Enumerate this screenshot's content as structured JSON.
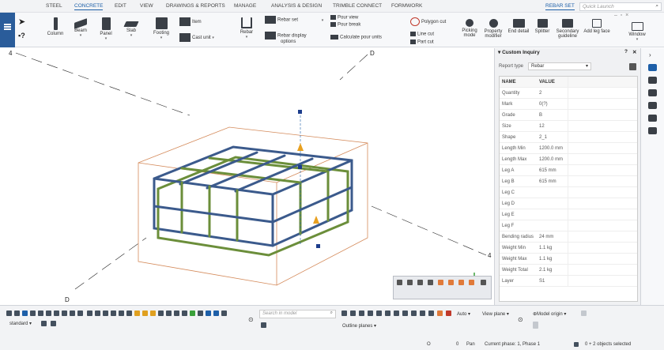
{
  "menu": {
    "tabs": [
      "STEEL",
      "CONCRETE",
      "EDIT",
      "VIEW",
      "DRAWINGS & REPORTS",
      "MANAGE",
      "ANALYSIS & DESIGN",
      "TRIMBLE CONNECT",
      "FORMWORK"
    ],
    "active_tab": "CONCRETE",
    "context_tab": "REBAR SET",
    "search_placeholder": "Quick Launch"
  },
  "ribbon": {
    "column": "Column",
    "beam": "Beam",
    "panel": "Panel",
    "slab": "Slab",
    "footing": "Footing",
    "item": "Item",
    "cast_unit": "Cast unit",
    "rebar": "Rebar",
    "rebar_set": "Rebar set",
    "rebar_display": "Rebar display",
    "options": "options",
    "pour_view": "Pour view",
    "pour_break": "Pour break",
    "calculate_pour_units": "Calculate pour units",
    "polygon_cut": "Polygon cut",
    "line_cut": "Line cut",
    "part_cut": "Part cut",
    "picking": "Picking",
    "mode": "mode",
    "property": "Property",
    "modifier": "modifier",
    "end_detail": "End detail",
    "splitter": "Splitter",
    "secondary": "Secondary",
    "guideline": "guideline",
    "add_leg_face": "Add leg face",
    "window": "Window"
  },
  "viewport": {
    "grid_labels": [
      "4",
      "D",
      "D",
      "4"
    ]
  },
  "panel": {
    "title": "Custom Inquiry",
    "report_type_label": "Report type",
    "report_type_value": "Rebar",
    "columns": [
      "NAME",
      "VALUE"
    ],
    "rows": [
      {
        "name": "Quantity",
        "value": "2"
      },
      {
        "name": "Mark",
        "value": "0(?)"
      },
      {
        "name": "Grade",
        "value": "B"
      },
      {
        "name": "Size",
        "value": "12"
      },
      {
        "name": "Shape",
        "value": "2_1"
      },
      {
        "name": "Length Min",
        "value": "1200.0 mm"
      },
      {
        "name": "Length Max",
        "value": "1200.0 mm"
      },
      {
        "name": "Leg A",
        "value": "615 mm"
      },
      {
        "name": "Leg B",
        "value": "615 mm"
      },
      {
        "name": "Leg C",
        "value": ""
      },
      {
        "name": "Leg D",
        "value": ""
      },
      {
        "name": "Leg E",
        "value": ""
      },
      {
        "name": "Leg F",
        "value": ""
      },
      {
        "name": "Bending radius",
        "value": "24 mm"
      },
      {
        "name": "Weight Min",
        "value": "1.1 kg"
      },
      {
        "name": "Weight Max",
        "value": "1.1 kg"
      },
      {
        "name": "Weight Total",
        "value": "2.1 kg"
      },
      {
        "name": "Layer",
        "value": "S1"
      }
    ]
  },
  "bottom": {
    "standard": "standard",
    "search_placeholder": "Search in model",
    "auto": "Auto",
    "view_plane": "View plane",
    "model_origin": "Model origin",
    "outline_planes": "Outline planes"
  },
  "status": {
    "o": "O",
    "zero": "0",
    "pan": "Pan",
    "phase": "Current phase: 1, Phase 1",
    "selected": "0 + 2 objects selected"
  },
  "colors": {
    "accent": "#1d5fa8",
    "rebar_blue": "#3b5a8c",
    "rebar_green": "#6b8e3a",
    "concrete_outline": "#d48a5a"
  }
}
